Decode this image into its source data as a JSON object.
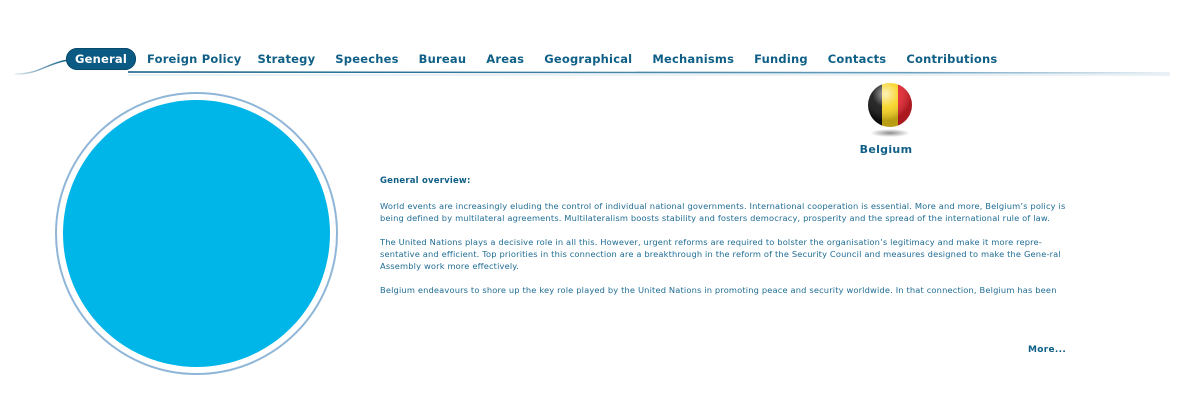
{
  "nav": {
    "tabs": [
      {
        "label": "General",
        "active": true
      },
      {
        "label": "Foreign Policy",
        "active": false
      },
      {
        "label": "Strategy",
        "active": false
      },
      {
        "label": "Speeches",
        "active": false
      },
      {
        "label": "Bureau",
        "active": false
      },
      {
        "label": "Areas",
        "active": false
      },
      {
        "label": "Geographical",
        "active": false
      },
      {
        "label": "Mechanisms",
        "active": false
      },
      {
        "label": "Funding",
        "active": false
      },
      {
        "label": "Contacts",
        "active": false
      },
      {
        "label": "Contributions",
        "active": false
      }
    ]
  },
  "country": {
    "name": "Belgium",
    "flag_icon": "belgium-flag-icon"
  },
  "content": {
    "heading": "General overview:",
    "paragraphs": [
      "World events are increasingly eluding the control of individual national governments. International cooperation is essential. More and more, Belgium’s policy is being defined by multilateral agreements. Multilateralism boosts stability and fosters democracy, prosperity and the spread of the international rule of law.",
      "The United Nations plays a decisive role in all this. However, urgent reforms are required to bolster the organisation’s legitimacy and make it more repre-sentative and efficient. Top priorities in this connection are a breakthrough in the reform of the Security Council and measures designed to make the Gene-ral Assembly work more effectively.",
      "Belgium endeavours to shore up the key role played by the United Nations in promoting peace and security worldwide. In that connection, Belgium has been"
    ],
    "more_label": "More..."
  },
  "colors": {
    "accent": "#0b5a83",
    "circle_fill": "#00b5e8",
    "circle_ring": "#8fb6d8",
    "text": "#1f6c93"
  }
}
